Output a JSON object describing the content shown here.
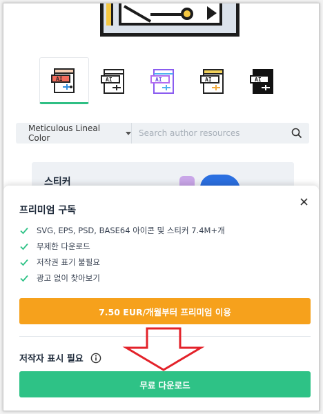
{
  "search": {
    "style_label": "Meticulous Lineal Color",
    "placeholder": "Search author resources"
  },
  "styles": [
    {
      "name": "lineal-color",
      "active": true
    },
    {
      "name": "lineal",
      "active": false
    },
    {
      "name": "gradient",
      "active": false
    },
    {
      "name": "flat",
      "active": false
    },
    {
      "name": "fill",
      "active": false
    }
  ],
  "sticker_card": {
    "title": "스티커"
  },
  "premium": {
    "title": "프리미엄 구독",
    "features": [
      "SVG, EPS, PSD, BASE64 아이콘 및 스티커 7.4M+개",
      "무제한 다운로드",
      "저작권 표기 불필요",
      "광고 없이 찾아보기"
    ],
    "cta_label": "7.50 EUR/개월부터 프리미엄 이용"
  },
  "attribution": {
    "label": "저작자 표시 필요"
  },
  "free_download": {
    "label": "무료 다운로드"
  },
  "colors": {
    "accent_green": "#2ec286",
    "accent_orange": "#f6a11c",
    "annotation_red": "#e3222a"
  }
}
